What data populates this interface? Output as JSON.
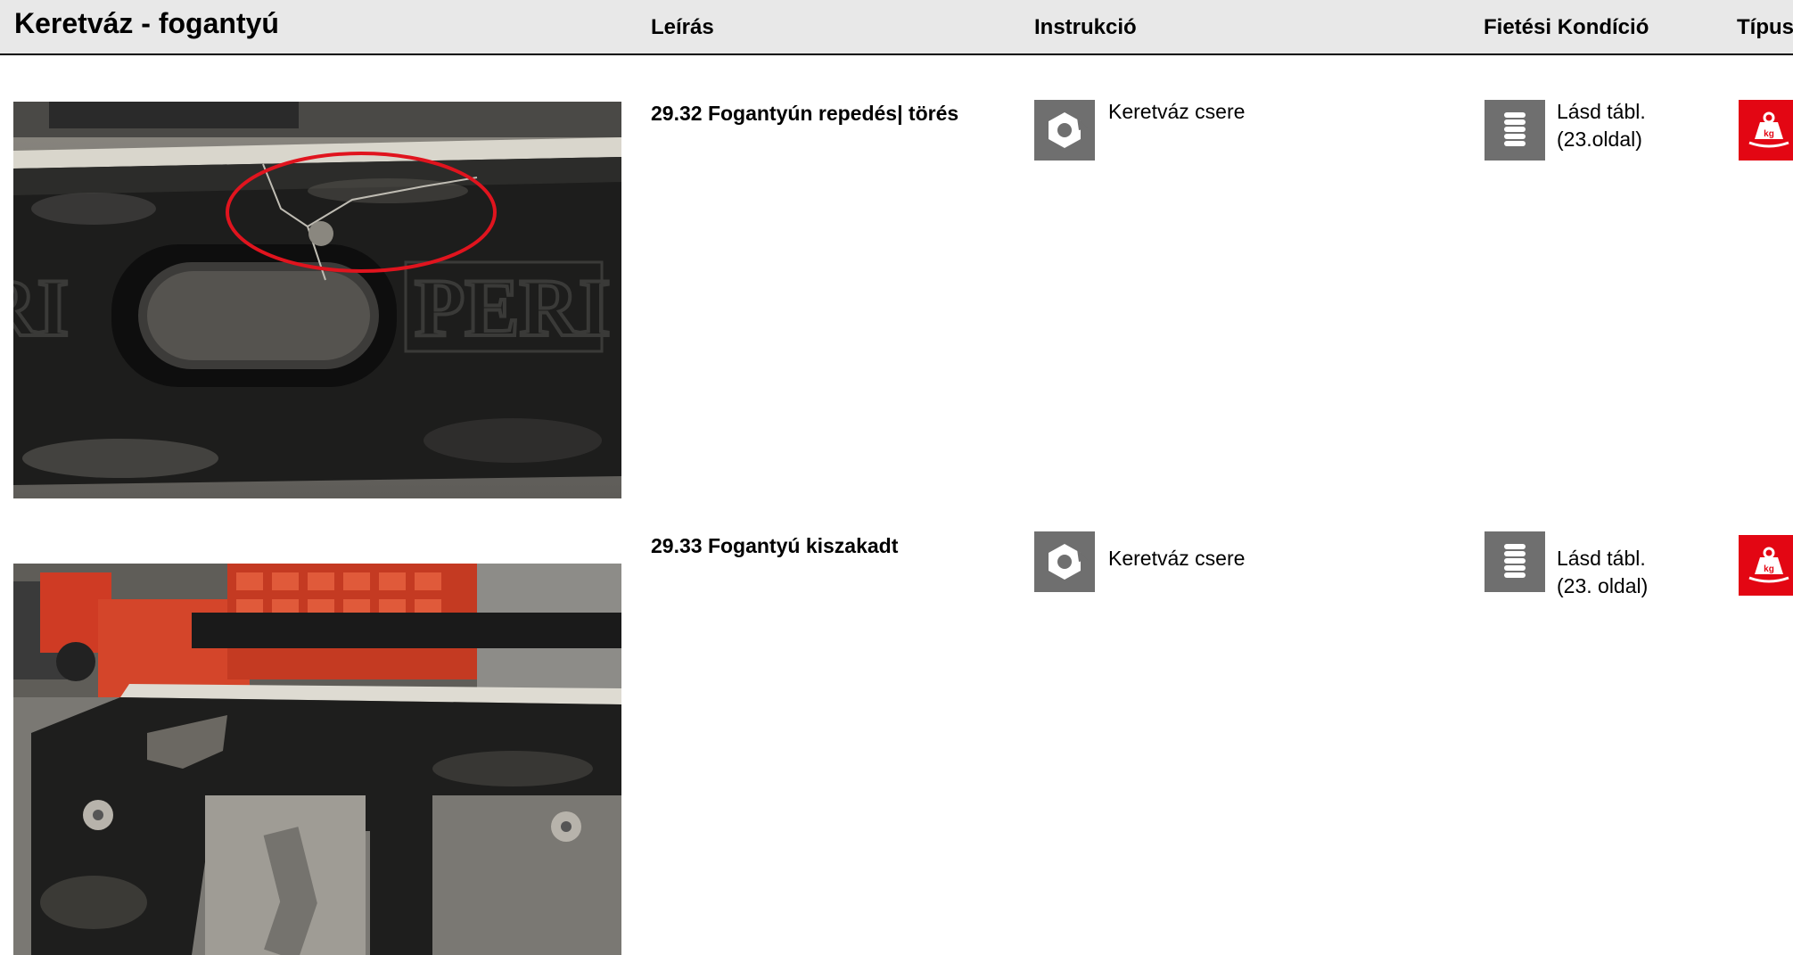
{
  "header": {
    "title": "Keretváz - fogantyú",
    "col_description": "Leírás",
    "col_instruction": "Instrukció",
    "col_billing": "Fietési Kondíció",
    "col_type": "Típus"
  },
  "rows": [
    {
      "code_description": "29.32  Fogantyún repedés| törés",
      "instruction_icon": "nut-replace-icon",
      "instruction_text": "Keretváz csere",
      "billing_icon": "coin-stack-icon",
      "billing_line1": "Lásd tábl.",
      "billing_line2": "(23.oldal)",
      "type_icon": "weight-kg-icon",
      "type_icon_label": "kg",
      "photo_logo_text": "PERI"
    },
    {
      "code_description": "29.33 Fogantyú kiszakadt",
      "instruction_icon": "nut-replace-icon",
      "instruction_text": "Keretváz csere",
      "billing_icon": "coin-stack-icon",
      "billing_line1": "Lásd tábl.",
      "billing_line2": "(23. oldal)",
      "type_icon": "weight-kg-icon",
      "type_icon_label": "kg"
    }
  ],
  "colors": {
    "header_bg": "#e8e8e8",
    "icon_gray": "#6f6f6f",
    "type_red": "#e30613",
    "damage_marker": "#e0141e"
  }
}
